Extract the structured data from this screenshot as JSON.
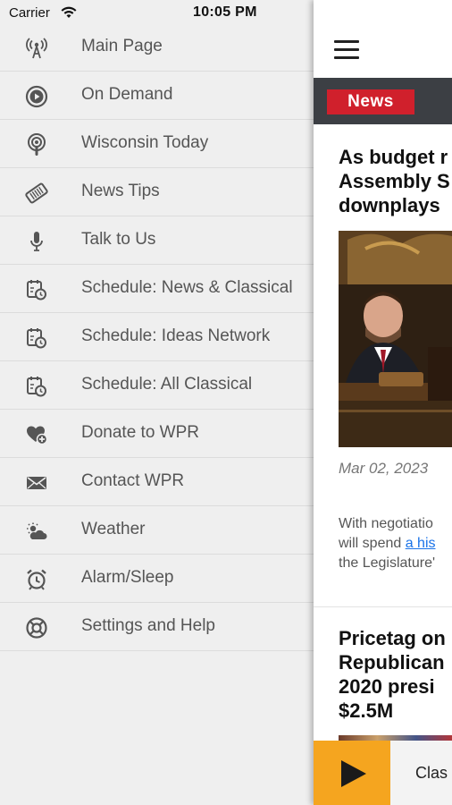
{
  "status_bar": {
    "carrier": "Carrier",
    "time": "10:05 PM"
  },
  "menu": {
    "items": [
      {
        "label": "Main Page",
        "icon": "radio-tower-icon"
      },
      {
        "label": "On Demand",
        "icon": "play-circle-icon"
      },
      {
        "label": "Wisconsin Today",
        "icon": "podcast-icon"
      },
      {
        "label": "News Tips",
        "icon": "ticket-icon"
      },
      {
        "label": "Talk to Us",
        "icon": "microphone-icon"
      },
      {
        "label": "Schedule: News & Classical",
        "icon": "schedule-icon"
      },
      {
        "label": "Schedule: Ideas Network",
        "icon": "schedule-icon"
      },
      {
        "label": "Schedule: All Classical",
        "icon": "schedule-icon"
      },
      {
        "label": "Donate to WPR",
        "icon": "heart-plus-icon"
      },
      {
        "label": "Contact WPR",
        "icon": "envelope-icon"
      },
      {
        "label": "Weather",
        "icon": "weather-icon"
      },
      {
        "label": "Alarm/Sleep",
        "icon": "alarm-clock-icon"
      },
      {
        "label": "Settings and Help",
        "icon": "help-icon"
      }
    ]
  },
  "content": {
    "section_badge": "News",
    "article1": {
      "title_lines": [
        "As budget r",
        "Assembly S",
        "downplays"
      ],
      "date": "Mar 02, 2023",
      "excerpt_line1": "With negotiatio",
      "excerpt_line2_prefix": "will spend ",
      "excerpt_link": "a his",
      "excerpt_line3": "the Legislature'"
    },
    "article2": {
      "title_lines": [
        "Pricetag on",
        "Republican",
        "2020 presi",
        "$2.5M"
      ]
    }
  },
  "player": {
    "label": "Clas"
  },
  "colors": {
    "news_badge": "#d0202c",
    "play_button": "#f5a51f",
    "section_bar": "#3c3f44",
    "link": "#1a73e8"
  }
}
